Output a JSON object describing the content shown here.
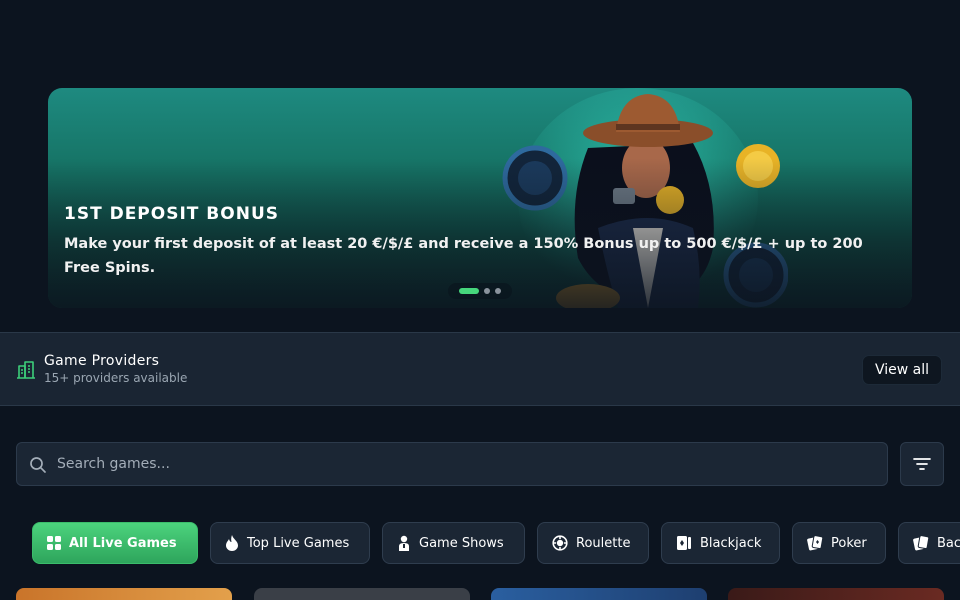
{
  "hero": {
    "title": "1ST DEPOSIT BONUS",
    "description": "Make your first deposit of at least 20 €/$/£ and receive a 150% Bonus up to 500 €/$/£ + up to 200 Free Spins.",
    "carousel": {
      "total_slides": 3,
      "active_index": 0
    }
  },
  "providers": {
    "title": "Game Providers",
    "subtitle": "15+ providers available",
    "view_all_label": "View all"
  },
  "search": {
    "placeholder": "Search games...",
    "value": ""
  },
  "categories": [
    {
      "label": "All Live Games",
      "icon": "grid-icon",
      "active": true
    },
    {
      "label": "Top Live Games",
      "icon": "fire-icon",
      "active": false
    },
    {
      "label": "Game Shows",
      "icon": "host-icon",
      "active": false
    },
    {
      "label": "Roulette",
      "icon": "roulette-icon",
      "active": false
    },
    {
      "label": "Blackjack",
      "icon": "cards-icon",
      "active": false
    },
    {
      "label": "Poker",
      "icon": "poker-icon",
      "active": false
    },
    {
      "label": "Bac",
      "icon": "baccarat-icon",
      "active": false
    }
  ],
  "colors": {
    "background": "#0c141f",
    "accent": "#46d67c",
    "panel": "#1a2533",
    "hero_teal": "#1e8a80"
  }
}
